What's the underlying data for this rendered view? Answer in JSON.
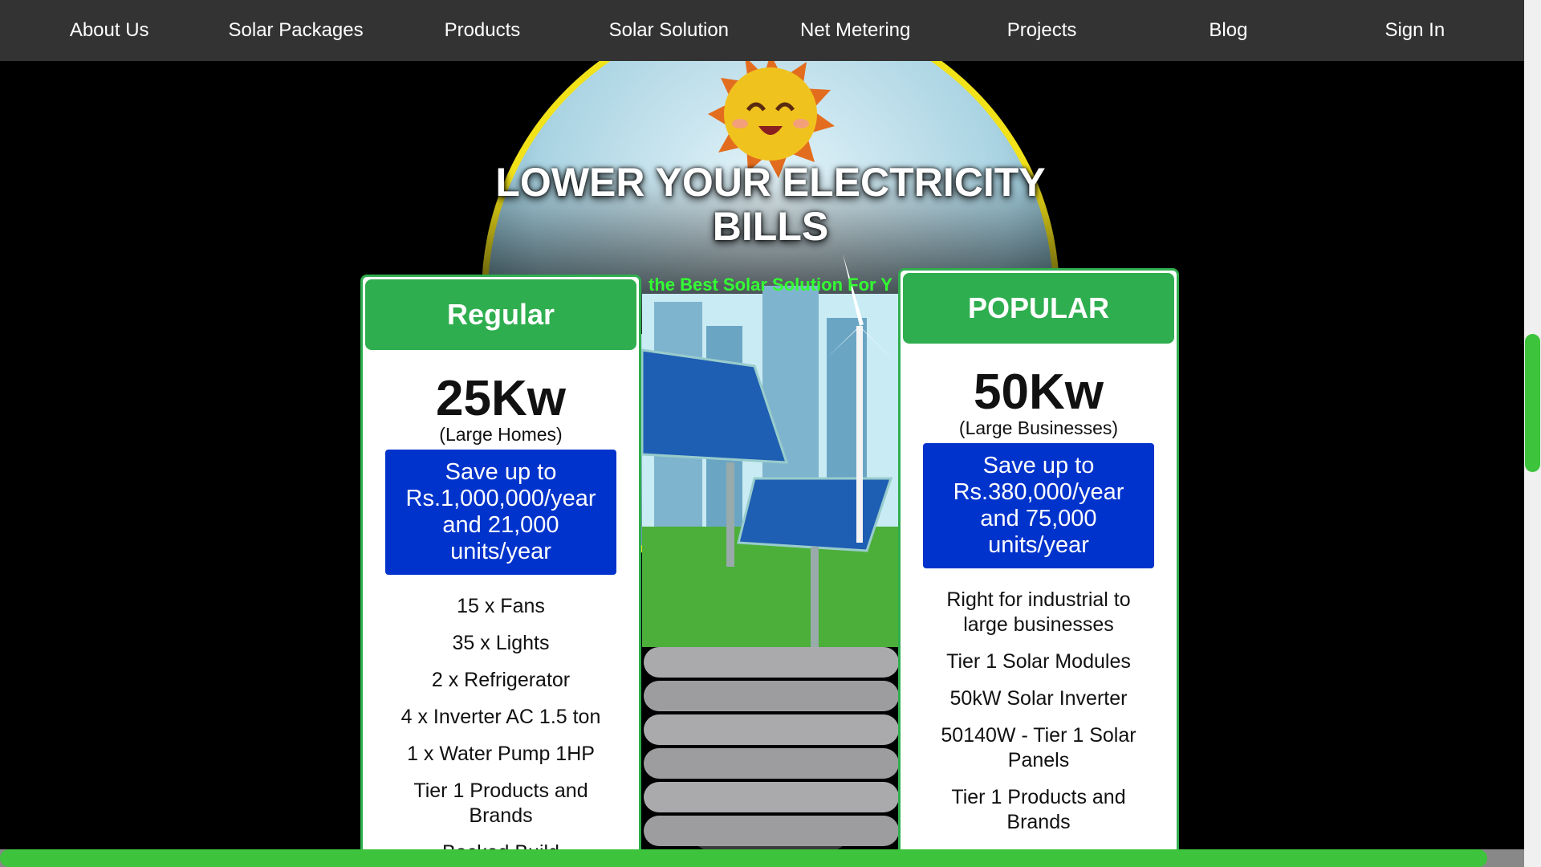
{
  "nav": {
    "items": [
      "About Us",
      "Solar Packages",
      "Products",
      "Solar Solution",
      "Net Metering",
      "Projects",
      "Blog",
      "Sign In"
    ]
  },
  "hero": {
    "title_line1": "LOWER YOUR ELECTRICITY",
    "title_line2": "BILLS",
    "tagline": "the Best Solar Solution For Y"
  },
  "cards": {
    "regular": {
      "tier": "Regular",
      "power": "25Kw",
      "audience": "(Large Homes)",
      "savings": "Save up to Rs.1,000,000/year and 21,000 units/year",
      "features": [
        "15 x Fans",
        "35 x Lights",
        "2 x Refrigerator",
        "4 x Inverter AC 1.5 ton",
        "1 x Water Pump 1HP",
        "Tier 1 Products and Brands",
        "Backed Build"
      ]
    },
    "popular": {
      "tier": "POPULAR",
      "power": "50Kw",
      "audience": "(Large Businesses)",
      "savings": "Save up to Rs.380,000/year and 75,000 units/year",
      "features": [
        "Right for industrial to large businesses",
        "Tier 1 Solar Modules",
        "50kW Solar Inverter",
        "50140W - Tier 1 Solar Panels",
        "Tier 1 Products and Brands"
      ]
    }
  },
  "colors": {
    "nav_bg": "#333333",
    "card_green": "#2fae4f",
    "save_blue": "#0033cc",
    "tagline_green": "#33ff33",
    "scrollbar_green": "#3ec43c"
  }
}
